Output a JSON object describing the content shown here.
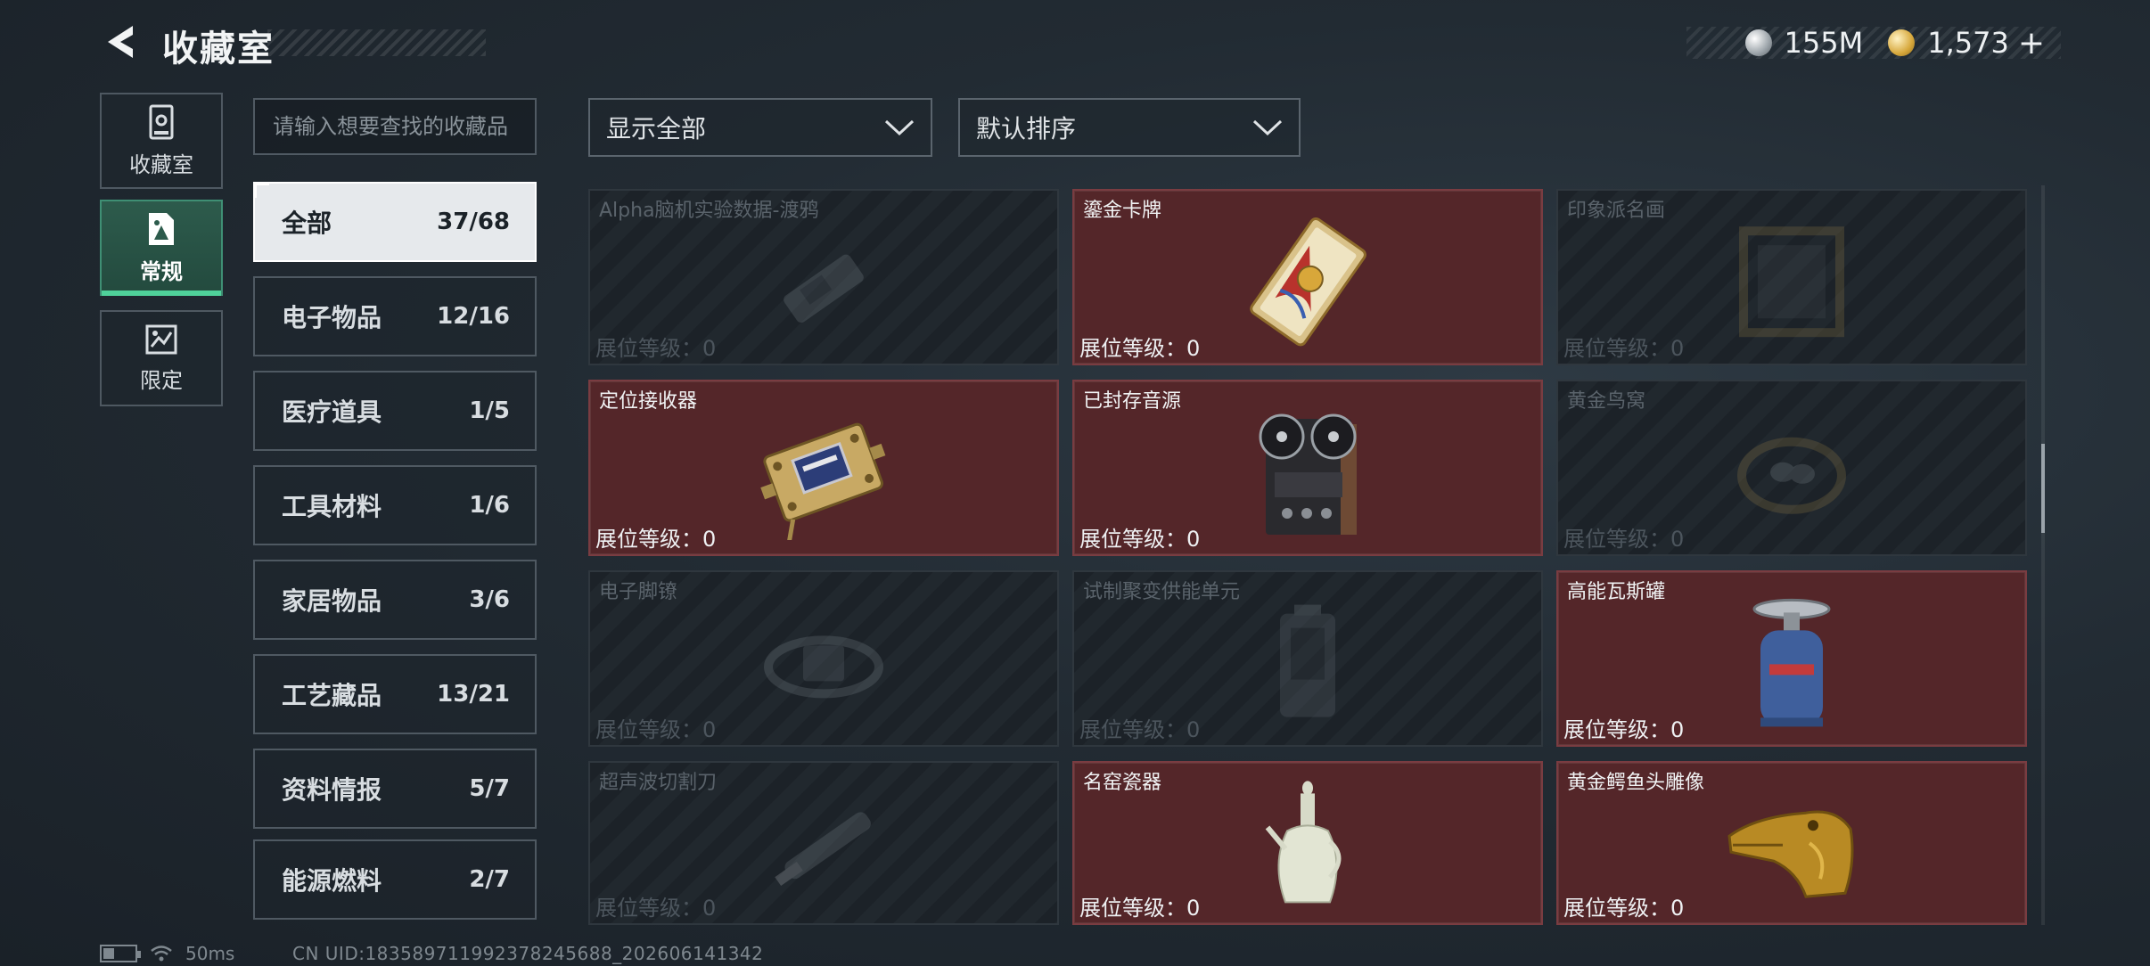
{
  "header": {
    "title": "收藏室",
    "currency": [
      {
        "icon": "silver-coin-icon",
        "value": "155M"
      },
      {
        "icon": "gold-coin-icon",
        "value": "1,573"
      }
    ],
    "add_symbol": "+"
  },
  "rail": [
    {
      "icon": "collection-room-icon",
      "label": "收藏室",
      "active": false
    },
    {
      "icon": "regular-category-icon",
      "label": "常规",
      "active": true
    },
    {
      "icon": "limited-category-icon",
      "label": "限定",
      "active": false
    }
  ],
  "search": {
    "placeholder": "请输入想要查找的收藏品"
  },
  "categories": [
    {
      "name": "全部",
      "count": "37/68",
      "active": true
    },
    {
      "name": "电子物品",
      "count": "12/16"
    },
    {
      "name": "医疗道具",
      "count": "1/5"
    },
    {
      "name": "工具材料",
      "count": "1/6"
    },
    {
      "name": "家居物品",
      "count": "3/6"
    },
    {
      "name": "工艺藏品",
      "count": "13/21"
    },
    {
      "name": "资料情报",
      "count": "5/7"
    },
    {
      "name": "能源燃料",
      "count": "2/7"
    }
  ],
  "filters": {
    "display": "显示全部",
    "sort": "默认排序"
  },
  "items": [
    {
      "name": "Alpha脑机实验数据-渡鸦",
      "level": "展位等级：0",
      "owned": false,
      "icon": "data-drive-icon"
    },
    {
      "name": "鎏金卡牌",
      "level": "展位等级：0",
      "owned": true,
      "icon": "gilded-card-icon"
    },
    {
      "name": "印象派名画",
      "level": "展位等级：0",
      "owned": false,
      "icon": "painting-icon"
    },
    {
      "name": "定位接收器",
      "level": "展位等级：0",
      "owned": true,
      "icon": "gps-receiver-icon"
    },
    {
      "name": "已封存音源",
      "level": "展位等级：0",
      "owned": true,
      "icon": "reel-tape-recorder-icon"
    },
    {
      "name": "黄金鸟窝",
      "level": "展位等级：0",
      "owned": false,
      "icon": "golden-nest-icon"
    },
    {
      "name": "电子脚镣",
      "level": "展位等级：0",
      "owned": false,
      "icon": "ankle-monitor-icon"
    },
    {
      "name": "试制聚变供能单元",
      "level": "展位等级：0",
      "owned": false,
      "icon": "fusion-cell-icon"
    },
    {
      "name": "高能瓦斯罐",
      "level": "展位等级：0",
      "owned": true,
      "icon": "gas-canister-icon"
    },
    {
      "name": "超声波切割刀",
      "level": "展位等级：0",
      "owned": false,
      "icon": "ultrasonic-cutter-icon"
    },
    {
      "name": "名窑瓷器",
      "level": "展位等级：0",
      "owned": true,
      "icon": "porcelain-ewer-icon"
    },
    {
      "name": "黄金鳄鱼头雕像",
      "level": "展位等级：0",
      "owned": true,
      "icon": "golden-crocodile-head-icon"
    }
  ],
  "status": {
    "ping": "50ms",
    "uid": "CN UID:183589711992378245688_202606141342"
  }
}
